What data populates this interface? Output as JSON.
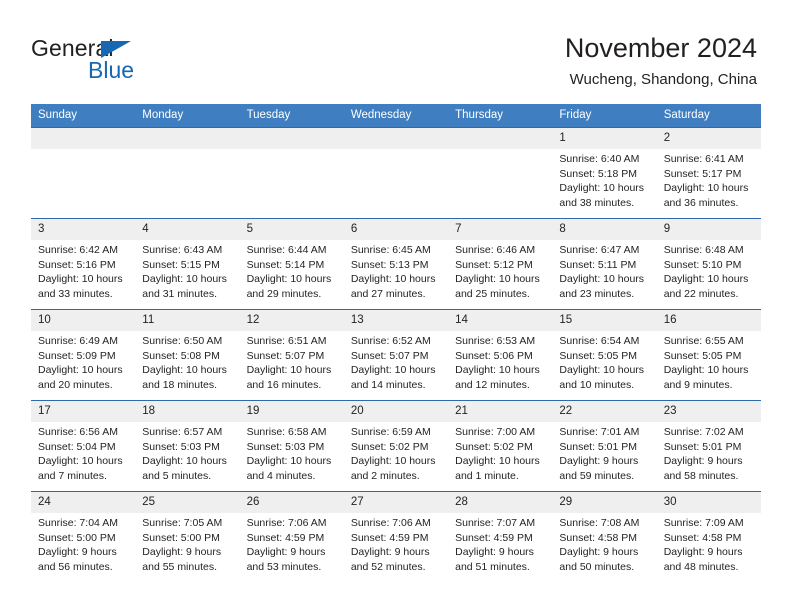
{
  "brand": {
    "name_part1": "General",
    "name_part2": "Blue",
    "color_blue": "#1668b3"
  },
  "header": {
    "title": "November 2024",
    "subtitle": "Wucheng, Shandong, China"
  },
  "calendar": {
    "header_bg": "#3f7fc1",
    "daynum_bg": "#efefef",
    "weekdays": [
      "Sunday",
      "Monday",
      "Tuesday",
      "Wednesday",
      "Thursday",
      "Friday",
      "Saturday"
    ],
    "labels": {
      "sunrise": "Sunrise:",
      "sunset": "Sunset:",
      "daylight": "Daylight:"
    },
    "weeks": [
      [
        {
          "day": "",
          "empty": true
        },
        {
          "day": "",
          "empty": true
        },
        {
          "day": "",
          "empty": true
        },
        {
          "day": "",
          "empty": true
        },
        {
          "day": "",
          "empty": true
        },
        {
          "day": "1",
          "sunrise": "Sunrise: 6:40 AM",
          "sunset": "Sunset: 5:18 PM",
          "daylight1": "Daylight: 10 hours",
          "daylight2": "and 38 minutes."
        },
        {
          "day": "2",
          "sunrise": "Sunrise: 6:41 AM",
          "sunset": "Sunset: 5:17 PM",
          "daylight1": "Daylight: 10 hours",
          "daylight2": "and 36 minutes."
        }
      ],
      [
        {
          "day": "3",
          "sunrise": "Sunrise: 6:42 AM",
          "sunset": "Sunset: 5:16 PM",
          "daylight1": "Daylight: 10 hours",
          "daylight2": "and 33 minutes."
        },
        {
          "day": "4",
          "sunrise": "Sunrise: 6:43 AM",
          "sunset": "Sunset: 5:15 PM",
          "daylight1": "Daylight: 10 hours",
          "daylight2": "and 31 minutes."
        },
        {
          "day": "5",
          "sunrise": "Sunrise: 6:44 AM",
          "sunset": "Sunset: 5:14 PM",
          "daylight1": "Daylight: 10 hours",
          "daylight2": "and 29 minutes."
        },
        {
          "day": "6",
          "sunrise": "Sunrise: 6:45 AM",
          "sunset": "Sunset: 5:13 PM",
          "daylight1": "Daylight: 10 hours",
          "daylight2": "and 27 minutes."
        },
        {
          "day": "7",
          "sunrise": "Sunrise: 6:46 AM",
          "sunset": "Sunset: 5:12 PM",
          "daylight1": "Daylight: 10 hours",
          "daylight2": "and 25 minutes."
        },
        {
          "day": "8",
          "sunrise": "Sunrise: 6:47 AM",
          "sunset": "Sunset: 5:11 PM",
          "daylight1": "Daylight: 10 hours",
          "daylight2": "and 23 minutes."
        },
        {
          "day": "9",
          "sunrise": "Sunrise: 6:48 AM",
          "sunset": "Sunset: 5:10 PM",
          "daylight1": "Daylight: 10 hours",
          "daylight2": "and 22 minutes."
        }
      ],
      [
        {
          "day": "10",
          "sunrise": "Sunrise: 6:49 AM",
          "sunset": "Sunset: 5:09 PM",
          "daylight1": "Daylight: 10 hours",
          "daylight2": "and 20 minutes."
        },
        {
          "day": "11",
          "sunrise": "Sunrise: 6:50 AM",
          "sunset": "Sunset: 5:08 PM",
          "daylight1": "Daylight: 10 hours",
          "daylight2": "and 18 minutes."
        },
        {
          "day": "12",
          "sunrise": "Sunrise: 6:51 AM",
          "sunset": "Sunset: 5:07 PM",
          "daylight1": "Daylight: 10 hours",
          "daylight2": "and 16 minutes."
        },
        {
          "day": "13",
          "sunrise": "Sunrise: 6:52 AM",
          "sunset": "Sunset: 5:07 PM",
          "daylight1": "Daylight: 10 hours",
          "daylight2": "and 14 minutes."
        },
        {
          "day": "14",
          "sunrise": "Sunrise: 6:53 AM",
          "sunset": "Sunset: 5:06 PM",
          "daylight1": "Daylight: 10 hours",
          "daylight2": "and 12 minutes."
        },
        {
          "day": "15",
          "sunrise": "Sunrise: 6:54 AM",
          "sunset": "Sunset: 5:05 PM",
          "daylight1": "Daylight: 10 hours",
          "daylight2": "and 10 minutes."
        },
        {
          "day": "16",
          "sunrise": "Sunrise: 6:55 AM",
          "sunset": "Sunset: 5:05 PM",
          "daylight1": "Daylight: 10 hours",
          "daylight2": "and 9 minutes."
        }
      ],
      [
        {
          "day": "17",
          "sunrise": "Sunrise: 6:56 AM",
          "sunset": "Sunset: 5:04 PM",
          "daylight1": "Daylight: 10 hours",
          "daylight2": "and 7 minutes."
        },
        {
          "day": "18",
          "sunrise": "Sunrise: 6:57 AM",
          "sunset": "Sunset: 5:03 PM",
          "daylight1": "Daylight: 10 hours",
          "daylight2": "and 5 minutes."
        },
        {
          "day": "19",
          "sunrise": "Sunrise: 6:58 AM",
          "sunset": "Sunset: 5:03 PM",
          "daylight1": "Daylight: 10 hours",
          "daylight2": "and 4 minutes."
        },
        {
          "day": "20",
          "sunrise": "Sunrise: 6:59 AM",
          "sunset": "Sunset: 5:02 PM",
          "daylight1": "Daylight: 10 hours",
          "daylight2": "and 2 minutes."
        },
        {
          "day": "21",
          "sunrise": "Sunrise: 7:00 AM",
          "sunset": "Sunset: 5:02 PM",
          "daylight1": "Daylight: 10 hours",
          "daylight2": "and 1 minute."
        },
        {
          "day": "22",
          "sunrise": "Sunrise: 7:01 AM",
          "sunset": "Sunset: 5:01 PM",
          "daylight1": "Daylight: 9 hours",
          "daylight2": "and 59 minutes."
        },
        {
          "day": "23",
          "sunrise": "Sunrise: 7:02 AM",
          "sunset": "Sunset: 5:01 PM",
          "daylight1": "Daylight: 9 hours",
          "daylight2": "and 58 minutes."
        }
      ],
      [
        {
          "day": "24",
          "sunrise": "Sunrise: 7:04 AM",
          "sunset": "Sunset: 5:00 PM",
          "daylight1": "Daylight: 9 hours",
          "daylight2": "and 56 minutes."
        },
        {
          "day": "25",
          "sunrise": "Sunrise: 7:05 AM",
          "sunset": "Sunset: 5:00 PM",
          "daylight1": "Daylight: 9 hours",
          "daylight2": "and 55 minutes."
        },
        {
          "day": "26",
          "sunrise": "Sunrise: 7:06 AM",
          "sunset": "Sunset: 4:59 PM",
          "daylight1": "Daylight: 9 hours",
          "daylight2": "and 53 minutes."
        },
        {
          "day": "27",
          "sunrise": "Sunrise: 7:06 AM",
          "sunset": "Sunset: 4:59 PM",
          "daylight1": "Daylight: 9 hours",
          "daylight2": "and 52 minutes."
        },
        {
          "day": "28",
          "sunrise": "Sunrise: 7:07 AM",
          "sunset": "Sunset: 4:59 PM",
          "daylight1": "Daylight: 9 hours",
          "daylight2": "and 51 minutes."
        },
        {
          "day": "29",
          "sunrise": "Sunrise: 7:08 AM",
          "sunset": "Sunset: 4:58 PM",
          "daylight1": "Daylight: 9 hours",
          "daylight2": "and 50 minutes."
        },
        {
          "day": "30",
          "sunrise": "Sunrise: 7:09 AM",
          "sunset": "Sunset: 4:58 PM",
          "daylight1": "Daylight: 9 hours",
          "daylight2": "and 48 minutes."
        }
      ]
    ]
  }
}
